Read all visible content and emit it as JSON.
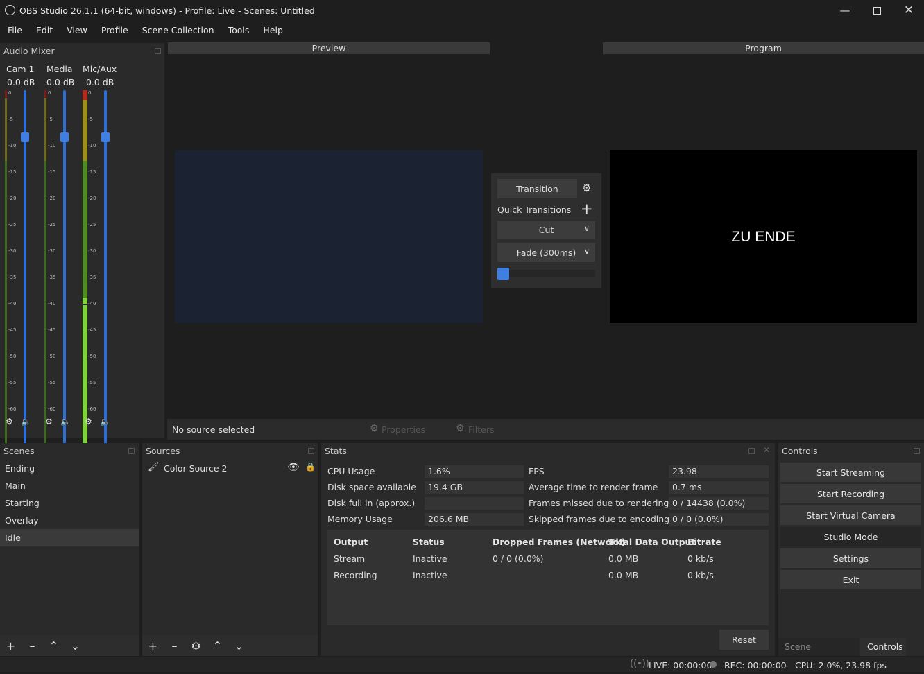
{
  "window": {
    "title": "OBS Studio 26.1.1 (64-bit, windows) - Profile: Live - Scenes: Untitled"
  },
  "menu": [
    "File",
    "Edit",
    "View",
    "Profile",
    "Scene Collection",
    "Tools",
    "Help"
  ],
  "mixer": {
    "title": "Audio Mixer",
    "scale": [
      "0",
      "-5",
      "-10",
      "-15",
      "-20",
      "-25",
      "-30",
      "-35",
      "-40",
      "-45",
      "-50",
      "-55",
      "-60"
    ],
    "channels": [
      {
        "name": "Cam 1",
        "db": "0.0 dB"
      },
      {
        "name": "Media",
        "db": "0.0 dB"
      },
      {
        "name": "Mic/Aux",
        "db": "0.0 dB"
      }
    ]
  },
  "preview": {
    "label": "Preview"
  },
  "program": {
    "label": "Program",
    "text": "ZU ENDE"
  },
  "transitions": {
    "transition_button": "Transition",
    "quick_label": "Quick Transitions",
    "cut": "Cut",
    "fade": "Fade (300ms)"
  },
  "source_bar": {
    "status": "No source selected",
    "properties": "Properties",
    "filters": "Filters"
  },
  "scenes": {
    "title": "Scenes",
    "items": [
      "Ending",
      "Main",
      "Starting",
      "Overlay",
      "Idle"
    ],
    "selected": "Idle"
  },
  "sources": {
    "title": "Sources",
    "items": [
      "Color Source 2"
    ]
  },
  "stats": {
    "title": "Stats",
    "left": [
      {
        "label": "CPU Usage",
        "value": "1.6%"
      },
      {
        "label": "Disk space available",
        "value": "19.4 GB"
      },
      {
        "label": "Disk full in (approx.)",
        "value": ""
      },
      {
        "label": "Memory Usage",
        "value": "206.6 MB"
      }
    ],
    "right": [
      {
        "label": "FPS",
        "value": "23.98"
      },
      {
        "label": "Average time to render frame",
        "value": "0.7 ms"
      },
      {
        "label": "Frames missed due to rendering lag",
        "value": "0 / 14438 (0.0%)"
      },
      {
        "label": "Skipped frames due to encoding lag",
        "value": "0 / 0 (0.0%)"
      }
    ],
    "table": {
      "headers": [
        "Output",
        "Status",
        "Dropped Frames (Network)",
        "Total Data Output",
        "Bitrate"
      ],
      "rows": [
        [
          "Stream",
          "Inactive",
          "0 / 0 (0.0%)",
          "0.0 MB",
          "0 kb/s"
        ],
        [
          "Recording",
          "Inactive",
          "",
          "0.0 MB",
          "0 kb/s"
        ]
      ]
    },
    "reset": "Reset"
  },
  "controls": {
    "title": "Controls",
    "buttons": [
      "Start Streaming",
      "Start Recording",
      "Start Virtual Camera",
      "Studio Mode",
      "Settings",
      "Exit"
    ],
    "tabs": [
      "Scene Transitions",
      "Controls"
    ]
  },
  "status": {
    "live": "LIVE: 00:00:00",
    "rec": "REC: 00:00:00",
    "cpu": "CPU: 2.0%, 23.98 fps"
  }
}
